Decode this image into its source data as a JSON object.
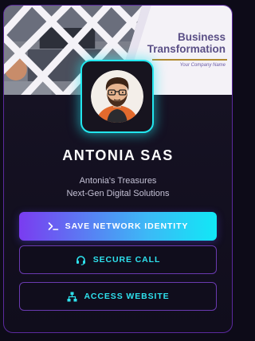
{
  "banner": {
    "title_line1": "Business",
    "title_line2": "Transformation",
    "company": "Your Company Name"
  },
  "profile": {
    "name": "ANTONIA SAS",
    "subtitle1": "Antonia's Treasures",
    "subtitle2": "Next-Gen Digital Solutions"
  },
  "buttons": {
    "save_label": "SAVE NETWORK IDENTITY",
    "call_label": "SECURE CALL",
    "website_label": "ACCESS WEBSITE"
  },
  "icons": {
    "save": "terminal-icon",
    "call": "headset-icon",
    "website": "network-icon"
  },
  "colors": {
    "accent_cyan": "#22e6ee",
    "accent_purple": "#7a3cf0",
    "border_purple": "#6a3ab0",
    "background": "#0d0b18"
  }
}
